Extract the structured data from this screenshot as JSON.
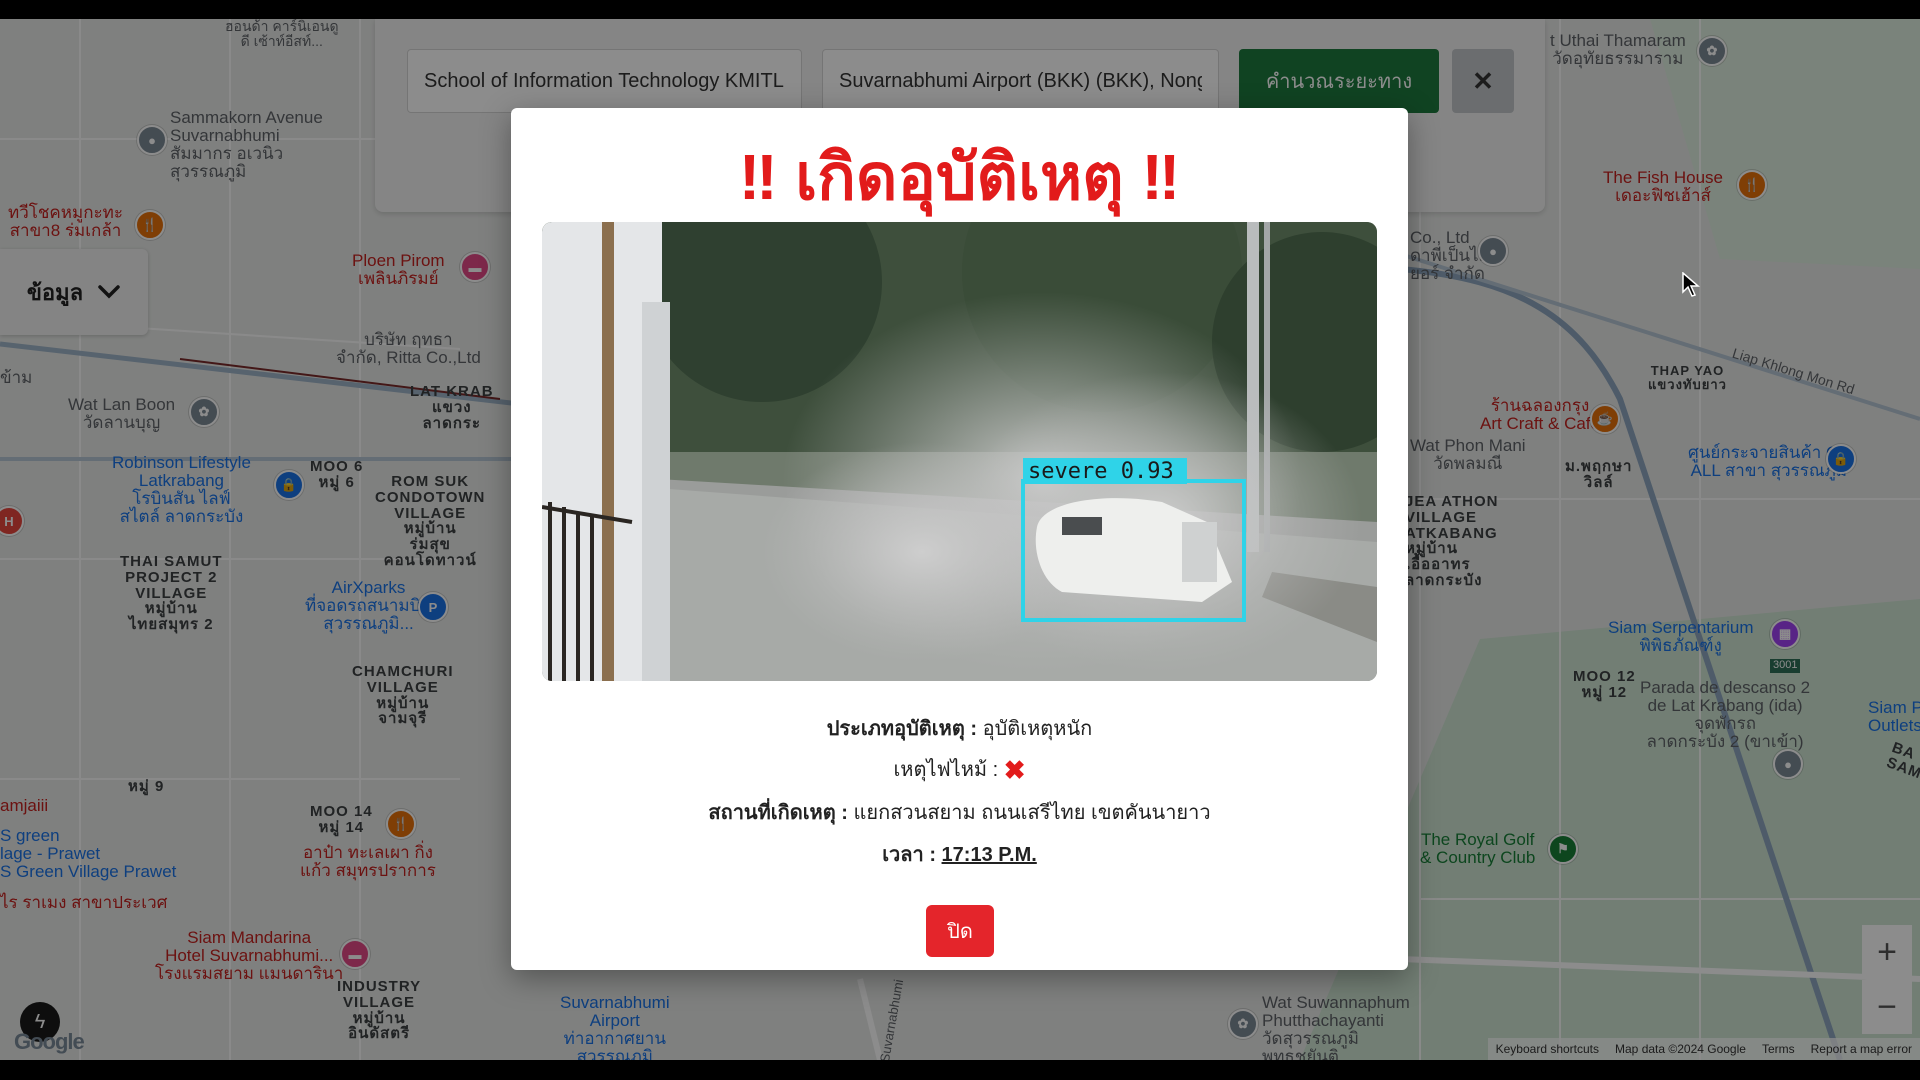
{
  "route": {
    "origin_value": "School of Information Technology KMITL",
    "destination_value": "Suvarnabhumi Airport (BKK) (BKK), Nong",
    "calculate_label": "คำนวณระยะทาง",
    "close_symbol": "✕"
  },
  "sidebar": {
    "info_label": "ข้อมูล",
    "chevron": "⌄"
  },
  "map_labels": {
    "l1": "ฮอนด้า คาร์นิเอนดู\nดี เซ้าท์อีสท์...",
    "l2": "Sammakorn Avenue\nSuvarnabhumi\nสัมมากร อเวนิว\nสุวรรณภูมิ",
    "l3": "ทวีโชคหมูกะทะ\nสาขา8 ร่มเกล้า",
    "l4": "Ploen Pirom\nเพลินภิรมย์",
    "l5": "บริษัท ฤทธา\nจำกัด, Ritta Co.,Ltd",
    "l6": "ข้าม",
    "l7": "LAT KRAB\nแขวง\nลาดกระ",
    "l8": "Wat Lan Boon\nวัดลานบุญ",
    "l9": "Robinson Lifestyle\nLatkrabang\nโรบินสัน ไลฟ์\nสไตล์ ลาดกระบัง",
    "l10": "MOO 6\nหมู่ 6",
    "l11": "ROM SUK\nCONDOTOWN\nVILLAGE\nหมู่บ้าน\nร่มสุข\nคอนโดทาวน์",
    "l12": "THAI SAMUT\nPROJECT 2\nVILLAGE\nหมู่บ้าน\nไทยสมุทร 2",
    "l13": "AirXparks\nที่จอดรถสนามบิน\nสุวรรณภูมิ...",
    "l14": "CHAMCHURI\nVILLAGE\nหมู่บ้าน\nจามจุรี",
    "l15": "หมู่ 9",
    "l16": "amjaiii",
    "l17": "S green\nlage - Prawet\nS Green Village Prawet",
    "l18": "MOO 14\nหมู่ 14",
    "l19": "อาป๋า ทะเลเผา กิ่ง\nแก้ว สมุทรปราการ",
    "l20": "ไร ราเมง สาขาประเวศ",
    "l21": "Siam Mandarina\nHotel Suvarnabhumi...\nโรงแรมสยาม แมนดารินา",
    "l22": "INDUSTRY\nVILLAGE\nหมู่บ้าน\nอินดัสตรี",
    "l23": "Suvarnabhumi\nAirport\nท่าอากาศยาน\nสุวรรณภูมิ",
    "l24": "Suvarnabhumi",
    "l25": "t Uthai Thamaram\nวัดอุทัยธรรมาราม",
    "l26": "The Fish House\nเดอะฟิชเฮ้าส์",
    "l27": "Co., Ltd\nดาพีเป็นไม\nยอร์ จำกัด",
    "l28": "Liap Khlong Mon Rd",
    "l29": "THAP YAO\nแขวงทับยาว",
    "l30": "ร้านฉลองกรุง\nArt Craft & Cafe",
    "l31": "Wat Phon Mani\nวัดพลมณี",
    "l32": "ม.พฤกษา\nวิลล์",
    "l33": "ศูนย์กระจายสินค้า CP\nALL สาขา สุวรรณภูมิ",
    "l34": "JEA ATHON\nVILLAGE\nATKABANG\nหมู่บ้าน\nเอื้ออาทร\nลาดกระบัง",
    "l35": "Siam Serpentarium\nพิพิธภัณฑ์งู",
    "l36": "MOO 12\nหมู่ 12",
    "l37": "Parada de descanso 2\nde Lat Krabang (ida)\nจุดพักรถ\nลาดกระบัง 2 (ขาเข้า)",
    "l38": "Siam P\nOutlets B",
    "l39": "3001",
    "l40": "BA\nSAMUT",
    "l41": "The Royal Golf\n& Country Club",
    "l42": "Wat Suwannaphum\nPhutthachayanti\nวัดสุวรรณภูมิ\nพุทธชยันติ",
    "l43": "H"
  },
  "modal": {
    "title": "‼ เกิดอุบัติเหตุ ‼",
    "detection_label": "severe  0.93",
    "type_label": "ประเภทอุบัติเหตุ :",
    "type_value": "อุบัติเหตุหนัก",
    "fire_label": "เหตุไฟไหม้ :",
    "fire_value": "✖",
    "location_label": "สถานที่เกิดเหตุ :",
    "location_value": "แยกสวนสยาม ถนนเสรีไทย เขตคันนายาว",
    "time_label": "เวลา :",
    "time_value": "17:13 P.M.",
    "close_label": "ปิด"
  },
  "map_controls": {
    "zoom_in": "+",
    "zoom_out": "−"
  },
  "footer": {
    "shortcuts": "Keyboard shortcuts",
    "map_data": "Map data ©2024 Google",
    "terms": "Terms",
    "report": "Report a map error"
  },
  "branding": {
    "google": "Google"
  },
  "colors": {
    "accent_red": "#e21b1b",
    "calc_green": "#1e7a3f",
    "close_red": "#e4252b"
  }
}
